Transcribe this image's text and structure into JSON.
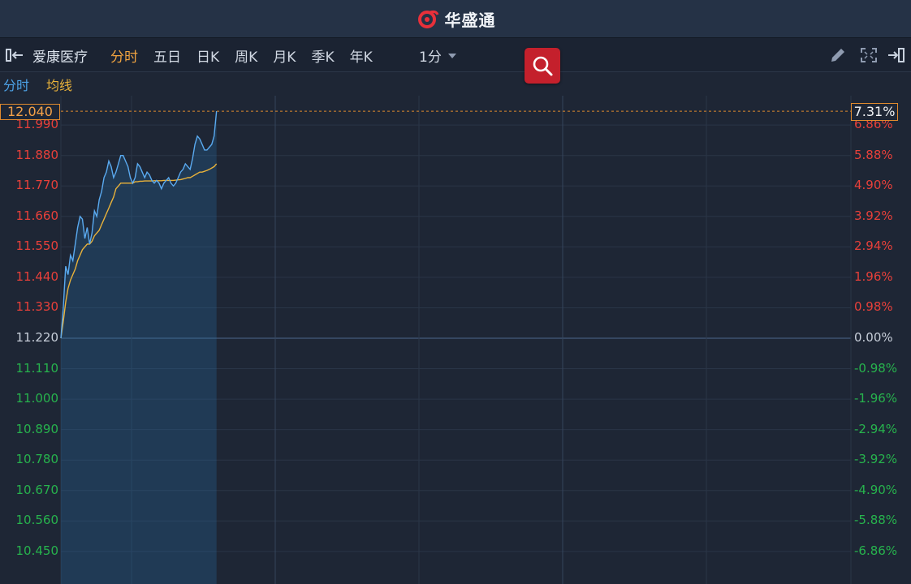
{
  "app": {
    "brand_name": "华盛通"
  },
  "toolbar": {
    "stock_name": "爱康医疗",
    "tabs": [
      {
        "label": "分时",
        "active": true
      },
      {
        "label": "五日",
        "active": false
      },
      {
        "label": "日K",
        "active": false
      },
      {
        "label": "周K",
        "active": false
      },
      {
        "label": "月K",
        "active": false
      },
      {
        "label": "季K",
        "active": false
      },
      {
        "label": "年K",
        "active": false
      }
    ],
    "interval": "1分"
  },
  "legend": {
    "timeshare": "分时",
    "average": "均线"
  },
  "chart_data": {
    "type": "line",
    "prev_close": 11.22,
    "current_price": "12.040",
    "current_change_pct": "7.31%",
    "y_ticks_left": [
      "11.990",
      "11.880",
      "11.770",
      "11.660",
      "11.550",
      "11.440",
      "11.330",
      "11.220",
      "11.110",
      "11.000",
      "10.890",
      "10.780",
      "10.670",
      "10.560",
      "10.450"
    ],
    "y_ticks_right": [
      "6.86%",
      "5.88%",
      "4.90%",
      "3.92%",
      "2.94%",
      "1.96%",
      "0.98%",
      "0.00%",
      "-0.98%",
      "-1.96%",
      "-2.94%",
      "-3.92%",
      "-4.90%",
      "-5.88%",
      "-6.86%"
    ],
    "ylim": [
      10.34,
      12.1
    ],
    "x_minutes_total": 330,
    "series": [
      {
        "name": "分时",
        "values": [
          11.22,
          11.33,
          11.48,
          11.45,
          11.52,
          11.5,
          11.56,
          11.62,
          11.66,
          11.65,
          11.58,
          11.62,
          11.56,
          11.6,
          11.68,
          11.66,
          11.72,
          11.75,
          11.8,
          11.82,
          11.86,
          11.84,
          11.8,
          11.82,
          11.85,
          11.88,
          11.88,
          11.86,
          11.84,
          11.8,
          11.78,
          11.8,
          11.85,
          11.84,
          11.82,
          11.8,
          11.82,
          11.81,
          11.79,
          11.78,
          11.79,
          11.78,
          11.76,
          11.78,
          11.79,
          11.8,
          11.78,
          11.77,
          11.78,
          11.8,
          11.82,
          11.83,
          11.85,
          11.84,
          11.83,
          11.87,
          11.92,
          11.95,
          11.94,
          11.92,
          11.9,
          11.9,
          11.91,
          11.92,
          11.95,
          12.04
        ]
      },
      {
        "name": "均线",
        "values": [
          11.22,
          11.28,
          11.35,
          11.4,
          11.43,
          11.45,
          11.47,
          11.5,
          11.52,
          11.54,
          11.55,
          11.56,
          11.56,
          11.57,
          11.59,
          11.6,
          11.61,
          11.63,
          11.65,
          11.67,
          11.69,
          11.71,
          11.73,
          11.76,
          11.77,
          11.78,
          11.78,
          11.78,
          11.78,
          11.78,
          11.78,
          11.785,
          11.785,
          11.787,
          11.787,
          11.788,
          11.788,
          11.788,
          11.788,
          11.789,
          11.789,
          11.789,
          11.789,
          11.79,
          11.79,
          11.79,
          11.79,
          11.79,
          11.791,
          11.792,
          11.793,
          11.795,
          11.797,
          11.8,
          11.8,
          11.805,
          11.81,
          11.815,
          11.82,
          11.82,
          11.823,
          11.826,
          11.83,
          11.835,
          11.84,
          11.85
        ]
      }
    ]
  }
}
